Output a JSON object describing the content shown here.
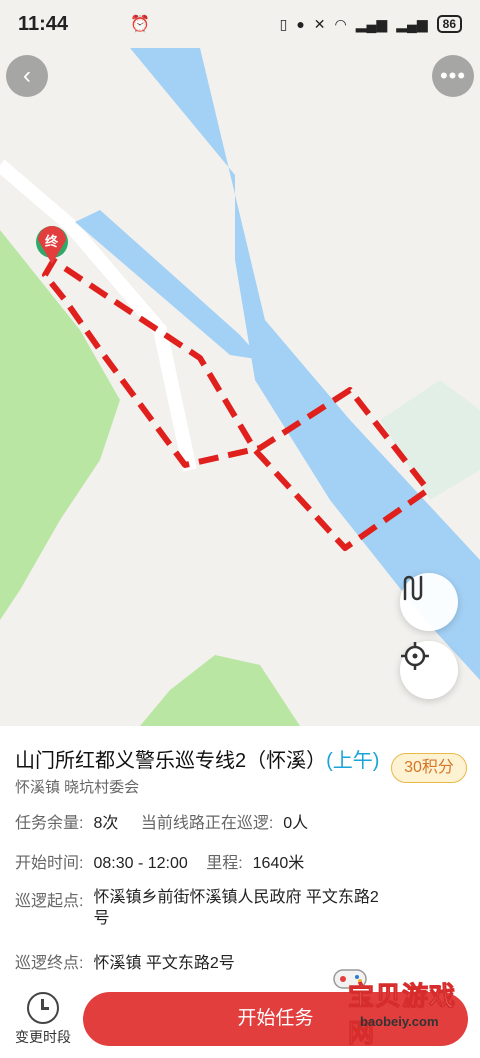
{
  "status_bar": {
    "time": "11:44",
    "alarm_icon": "alarm-clock-icon",
    "battery": "86"
  },
  "map": {
    "back_icon": "chevron-left-icon",
    "more_icon": "more-dots-icon",
    "end_marker_label": "终",
    "route_color": "#e0201c",
    "river_color": "#a3d1f5",
    "green_color": "#b8e6a0"
  },
  "task": {
    "title": "山门所红都义警乐巡专线2（怀溪）",
    "title_tag": "(上午)",
    "points_badge": "30积分",
    "location": "怀溪镇 晓坑村委会",
    "remaining_label": "任务余量:",
    "remaining_value": "8次",
    "patrolling_label": "当前线路正在巡逻:",
    "patrolling_value": "0人",
    "start_time_label": "开始时间:",
    "start_time_value": "08:30 - 12:00",
    "distance_label": "里程:",
    "distance_value": "1640米",
    "start_point_label": "巡逻起点:",
    "start_point_value": "怀溪镇乡前街怀溪镇人民政府 平文东路2号",
    "end_point_label": "巡逻终点:",
    "end_point_value": "怀溪镇 平文东路2号"
  },
  "actions": {
    "change_slot_label": "变更时段",
    "start_task_label": "开始任务"
  },
  "watermark": {
    "title": "宝贝游戏网",
    "url": "baobeiy.com"
  }
}
